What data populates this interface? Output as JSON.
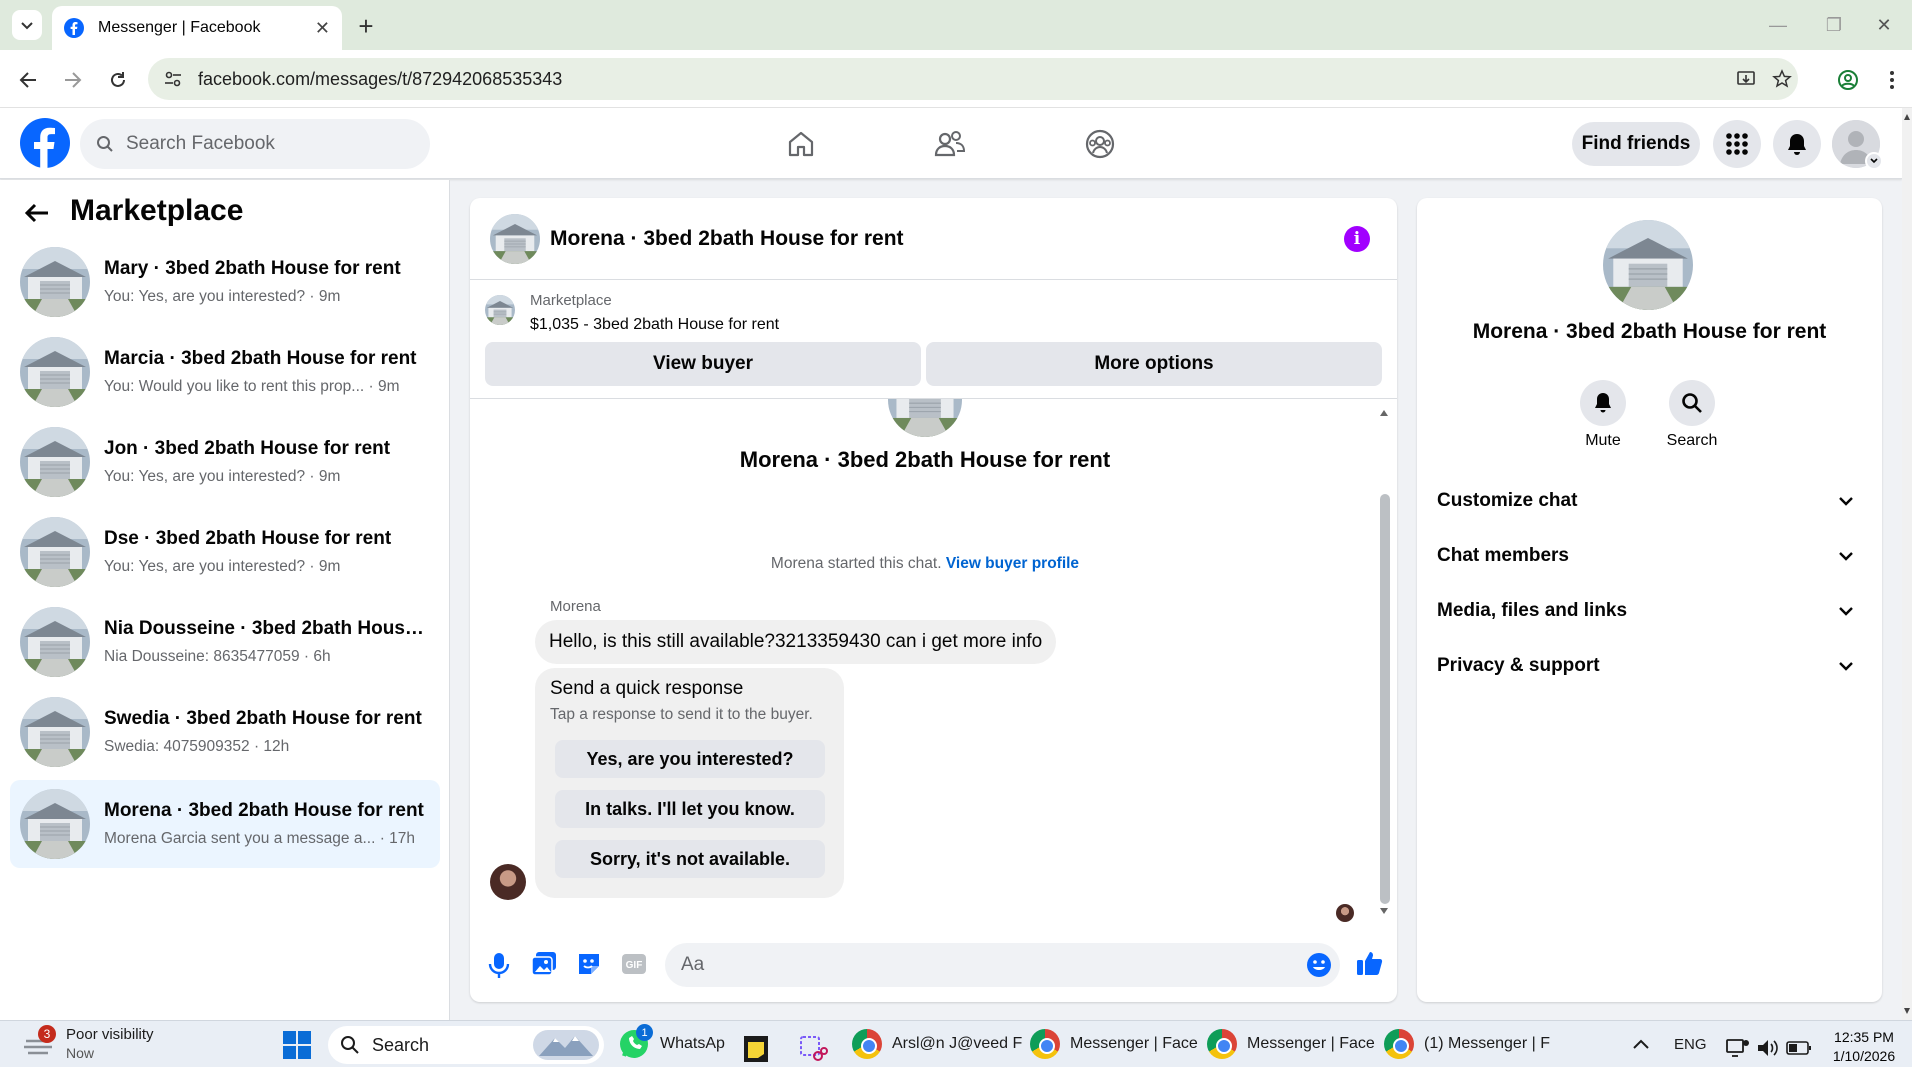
{
  "browser": {
    "tab_title": "Messenger | Facebook",
    "url": "facebook.com/messages/t/872942068535343"
  },
  "fb_header": {
    "search_placeholder": "Search Facebook",
    "find_friends": "Find friends"
  },
  "sidebar": {
    "title": "Marketplace",
    "conversations": [
      {
        "name": "Mary · 3bed 2bath House for rent",
        "preview": "You: Yes, are you interested? · 9m",
        "active": false
      },
      {
        "name": "Marcia · 3bed 2bath House for rent",
        "preview": "You: Would you like to rent this prop... · 9m",
        "active": false
      },
      {
        "name": "Jon · 3bed 2bath House for rent",
        "preview": "You: Yes, are you interested? · 9m",
        "active": false
      },
      {
        "name": "Dse · 3bed 2bath House for rent",
        "preview": "You: Yes, are you interested? · 9m",
        "active": false
      },
      {
        "name": "Nia Dousseine · 3bed 2bath House...",
        "preview": "Nia Dousseine: 8635477059 · 6h",
        "active": false
      },
      {
        "name": "Swedia · 3bed 2bath House for rent",
        "preview": "Swedia: 4075909352 · 12h",
        "active": false
      },
      {
        "name": "Morena · 3bed 2bath House for rent",
        "preview": "Morena Garcia sent you a message a... · 17h",
        "active": true
      }
    ]
  },
  "chat": {
    "title": "Morena · 3bed 2bath House for rent",
    "listing_label": "Marketplace",
    "listing_price": "$1,035 - 3bed 2bath House for rent",
    "view_buyer": "View buyer",
    "more_options": "More options",
    "center_name": "Morena · 3bed 2bath House for rent",
    "started_text": "Morena started this chat.",
    "view_buyer_profile": "View buyer profile",
    "sender": "Morena",
    "message": "Hello, is this still available?3213359430 can i get more info",
    "quick_title": "Send a quick response",
    "quick_sub": "Tap a response to send it to the buyer.",
    "quick_responses": [
      "Yes, are you interested?",
      "In talks. I'll let you know.",
      "Sorry, it's not available."
    ],
    "composer_placeholder": "Aa"
  },
  "info_panel": {
    "name": "Morena · 3bed 2bath House for rent",
    "mute": "Mute",
    "search": "Search",
    "sections": [
      "Customize chat",
      "Chat members",
      "Media, files and links",
      "Privacy & support"
    ]
  },
  "taskbar": {
    "weather_badge": "3",
    "weather_title": "Poor visibility",
    "weather_sub": "Now",
    "search": "Search",
    "whatsapp": "WhatsAp",
    "whatsapp_badge": "1",
    "apps": [
      "Arsl@n J@veed F",
      "Messenger | Face",
      "Messenger | Face",
      "(1) Messenger | F"
    ],
    "lang": "ENG",
    "time": "12:35 PM",
    "date": "1/10/2026"
  },
  "colors": {
    "fb_blue": "#0866ff",
    "link_blue": "#0064d1",
    "info_purple": "#a100ff",
    "active_row": "#ebf5ff"
  }
}
